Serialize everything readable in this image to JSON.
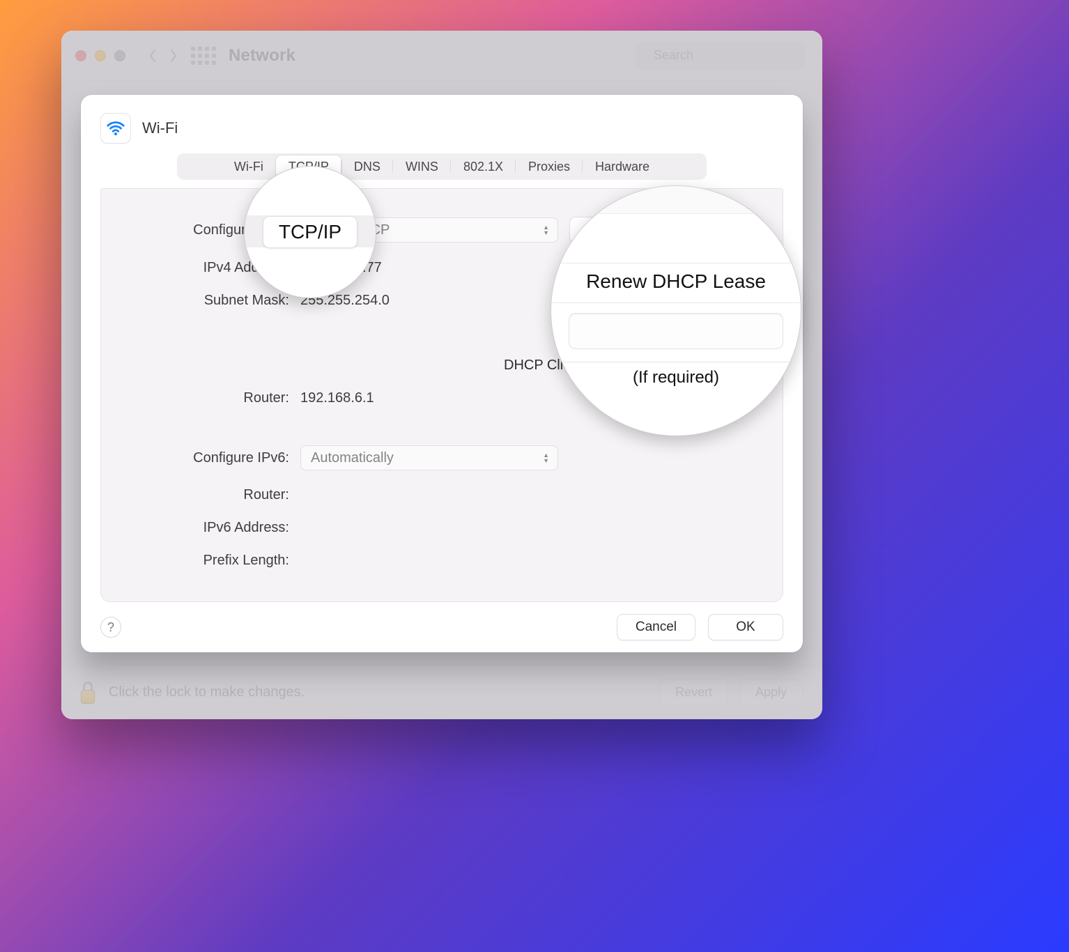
{
  "window": {
    "title": "Network",
    "search_placeholder": "Search"
  },
  "footer": {
    "lock_label": "Click the lock to make changes.",
    "revert": "Revert",
    "apply": "Apply"
  },
  "sheet": {
    "title": "Wi-Fi",
    "tabs": {
      "wifi": "Wi-Fi",
      "tcpip": "TCP/IP",
      "dns": "DNS",
      "wins": "WINS",
      "dot1x": "802.1X",
      "proxies": "Proxies",
      "hardware": "Hardware"
    },
    "active_tab": "tcpip",
    "labels": {
      "configure_ipv4": "Configure IPv4:",
      "ipv4_address": "IPv4 Address:",
      "subnet_mask": "Subnet Mask:",
      "router4": "Router:",
      "configure_ipv6": "Configure IPv6:",
      "router6": "Router:",
      "ipv6_address": "IPv6 Address:",
      "prefix_length": "Prefix Length:",
      "dhcp_client_id": "DHCP Client ID:",
      "if_required": "(If required)"
    },
    "values": {
      "configure_ipv4": "Using DHCP",
      "ipv4_address": "192.168.7.77",
      "subnet_mask": "255.255.254.0",
      "router4": "192.168.6.1",
      "configure_ipv6": "Automatically",
      "router6": "",
      "ipv6_address": "",
      "prefix_length": "",
      "dhcp_client_id": ""
    },
    "buttons": {
      "renew_dhcp_lease": "Renew DHCP Lease",
      "cancel": "Cancel",
      "ok": "OK",
      "help": "?"
    }
  },
  "callouts": {
    "tcpip_tab": "TCP/IP",
    "renew": "Renew DHCP Lease",
    "if_required": "(If required)"
  }
}
